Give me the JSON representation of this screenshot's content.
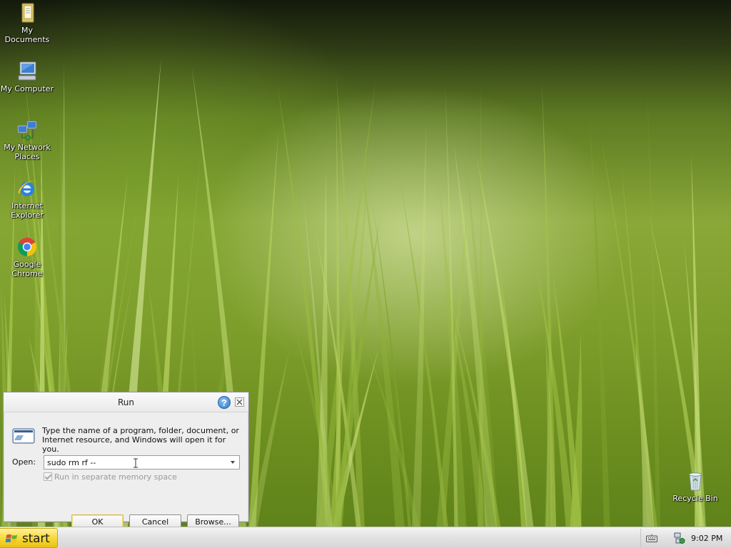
{
  "desktop": {
    "icons": [
      {
        "label": "My Documents",
        "icon": "folder-documents-icon"
      },
      {
        "label": "My Computer",
        "icon": "computer-icon"
      },
      {
        "label": "My Network Places",
        "icon": "network-icon"
      },
      {
        "label": "Internet Explorer",
        "icon": "internet-explorer-icon"
      },
      {
        "label": "Google Chrome",
        "icon": "chrome-icon"
      },
      {
        "label": "Recycle Bin",
        "icon": "recycle-bin-icon"
      }
    ]
  },
  "run_dialog": {
    "title": "Run",
    "description": "Type the name of a program, folder, document, or Internet resource, and Windows will open it for you.",
    "open_label": "Open:",
    "open_value": "sudo rm rf --",
    "separate_memory_label": "Run in separate memory space",
    "separate_memory_checked": true,
    "separate_memory_enabled": false,
    "ok_label": "OK",
    "cancel_label": "Cancel",
    "browse_label": "Browse...",
    "help_glyph": "?"
  },
  "taskbar": {
    "start_label": "start",
    "clock": "9:02 PM"
  },
  "colors": {
    "start_button": "#f7da3a",
    "taskbar": "#e3e3e3",
    "dialog_bg": "#eeeeee"
  }
}
